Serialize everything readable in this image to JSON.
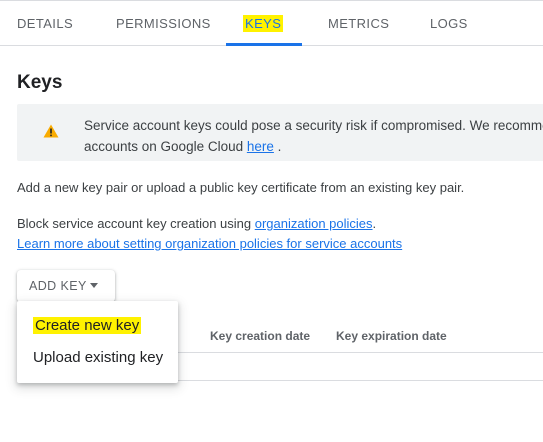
{
  "tabs": [
    {
      "label": "DETAILS"
    },
    {
      "label": "PERMISSIONS"
    },
    {
      "label": "KEYS"
    },
    {
      "label": "METRICS"
    },
    {
      "label": "LOGS"
    }
  ],
  "page": {
    "title": "Keys"
  },
  "banner": {
    "icon": "warning-icon",
    "line1": "Service account keys could pose a security risk if compromised. We recommend",
    "line2_prefix": "accounts on Google Cloud ",
    "link": "here",
    "line2_suffix": " ."
  },
  "body": {
    "add_key_text": "Add a new key pair or upload a public key certificate from an existing key pair.",
    "block_prefix": "Block service account key creation using ",
    "block_link": "organization policies",
    "block_suffix": ".",
    "learn_more_link": "Learn more about setting organization policies for service accounts"
  },
  "add_key_button": {
    "label": "ADD KEY"
  },
  "table": {
    "columns": [
      "Key creation date",
      "Key expiration date"
    ]
  },
  "menu": {
    "items": [
      "Create new key",
      "Upload existing key"
    ]
  },
  "colors": {
    "accent": "#1a73e8",
    "highlight": "#fff200",
    "banner_bg": "#f1f3f4",
    "warning": "#f9ab00"
  }
}
